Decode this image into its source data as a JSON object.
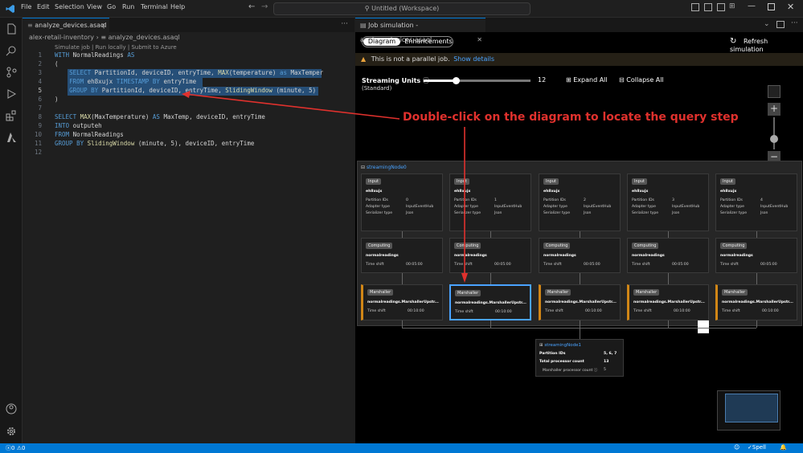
{
  "window": {
    "menus": [
      "File",
      "Edit",
      "Selection",
      "View",
      "Go",
      "Run",
      "Terminal",
      "Help"
    ],
    "search_text": "Untitled (Workspace)"
  },
  "editor": {
    "tab_label": "analyze_devices.asaql",
    "breadcrumb": [
      "alex-retail-inventory",
      "analyze_devices.asaql"
    ],
    "codelens": "Simulate job | Run locally | Submit to Azure",
    "lines": [
      "WITH NormalReadings AS",
      "(",
      "    SELECT PartitionId, deviceID, entryTime, MAX(temperature) as MaxTemper",
      "    FROM eh8xujx TIMESTAMP BY entryTime",
      "    GROUP BY PartitionId, deviceID, entryTime, SlidingWindow (minute, 5)",
      ")",
      "",
      "SELECT MAX(MaxTemperature) AS MaxTemp, deviceID, entryTime",
      "INTO outputeh",
      "FROM NormalReadings",
      "GROUP BY SlidingWindow (minute, 5), deviceID, entryTime",
      ""
    ],
    "line_numbers": [
      "1",
      "2",
      "3",
      "4",
      "5",
      "6",
      "7",
      "8",
      "9",
      "10",
      "11",
      "12"
    ]
  },
  "simulation": {
    "tab_label": "Job simulation - analyze_devices.asaql",
    "toggle_diagram": "Diagram",
    "toggle_enhancements": "Enhancements",
    "refresh_label": "Refresh simulation",
    "warning_text": "This is not a parallel job.",
    "warning_link": "Show details",
    "streaming_units_label": "Streaming Units",
    "streaming_units_sub": "(Standard)",
    "streaming_units_value": "12",
    "slider_fraction": 0.3,
    "expand_all": "Expand All",
    "collapse_all": "Collapse All",
    "annotation": "Double-click on the diagram to locate the query step",
    "group_label": "streamingNode0",
    "input_nodes": [
      {
        "badge": "Input",
        "name": "eh8xujx",
        "pid": "0",
        "adapter": "InputEventHub",
        "serializer": "Json"
      },
      {
        "badge": "Input",
        "name": "eh8xujx",
        "pid": "1",
        "adapter": "InputEventHub",
        "serializer": "Json"
      },
      {
        "badge": "Input",
        "name": "eh8xujx",
        "pid": "2",
        "adapter": "InputEventHub",
        "serializer": "Json"
      },
      {
        "badge": "Input",
        "name": "eh8xujx",
        "pid": "3",
        "adapter": "InputEventHub",
        "serializer": "Json"
      },
      {
        "badge": "Input",
        "name": "eh8xujx",
        "pid": "4",
        "adapter": "InputEventHub",
        "serializer": "Json"
      }
    ],
    "input_labels": {
      "pid": "Partition IDs",
      "adapter": "Adapter type",
      "serializer": "Serializer type"
    },
    "computing_nodes": {
      "badge": "Computing",
      "name": "normalreadings",
      "ts_label": "Time shift",
      "ts_value": "00:05:00"
    },
    "marshaller_nodes": {
      "badge": "Marshaller",
      "name": "normalreadings.MarshallerUpstr...",
      "ts_label": "Time shift",
      "ts_value": "00:10:00"
    },
    "node1": {
      "label": "streamingNode1",
      "pid_label": "Partition IDs",
      "pid_value": "5, 6, 7",
      "tpc_label": "Total processor count",
      "tpc_value": "13",
      "mpc_label": "Marshaller processor count",
      "mpc_value": "5"
    }
  },
  "status": {
    "errors": "0",
    "warnings": "0",
    "spell": "Spell"
  },
  "colors": {
    "accent": "#0078d4",
    "annotation": "#e0312d",
    "orange": "#d18616"
  }
}
